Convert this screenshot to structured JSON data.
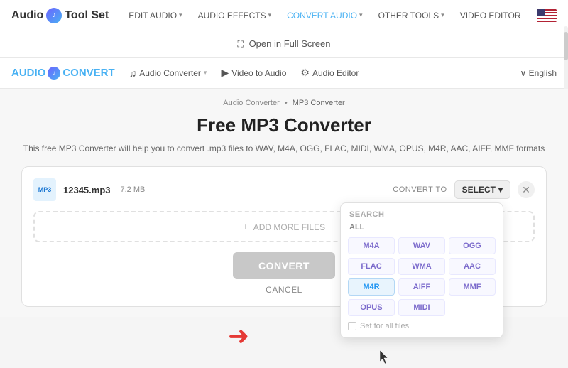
{
  "logo": {
    "text_before": "Audio",
    "text_after": "Tool Set",
    "icon_letter": "♪"
  },
  "top_nav": {
    "items": [
      {
        "label": "EDIT AUDIO",
        "has_chevron": true,
        "active": false
      },
      {
        "label": "AUDIO EFFECTS",
        "has_chevron": true,
        "active": false
      },
      {
        "label": "CONVERT AUDIO",
        "has_chevron": true,
        "active": true
      },
      {
        "label": "OTHER TOOLS",
        "has_chevron": true,
        "active": false
      },
      {
        "label": "VIDEO EDITOR",
        "has_chevron": false,
        "active": false
      }
    ]
  },
  "fullscreen_bar": {
    "text": "Open in Full Screen",
    "icon": "⛶"
  },
  "inner_nav": {
    "logo": "AUDIO",
    "logo_icon": "♪",
    "logo_suffix": "CONVERT",
    "items": [
      {
        "label": "Audio Converter",
        "icon": "♫",
        "has_chevron": true
      },
      {
        "label": "Video to Audio",
        "icon": "▶"
      },
      {
        "label": "Audio Editor",
        "icon": "⚙"
      }
    ],
    "language": "English"
  },
  "breadcrumb": {
    "parent": "Audio Converter",
    "current": "MP3 Converter"
  },
  "page": {
    "title": "Free MP3 Converter",
    "description": "This free MP3 Converter will help you to convert .mp3 files to WAV, M4A, OGG, FLAC, MIDI, WMA, OPUS, M4R, AAC, AIFF, MMF formats"
  },
  "file": {
    "name": "12345.mp3",
    "size": "7.2 MB",
    "icon_label": "MP3"
  },
  "converter": {
    "convert_to_label": "CONVERT TO",
    "select_btn_label": "SELECT",
    "select_chevron": "▾",
    "add_more_label": "ADD MORE FILES",
    "convert_btn": "CONVERT",
    "cancel_btn": "CANCEL"
  },
  "dropdown": {
    "search_label": "SEARCH",
    "all_label": "ALL",
    "formats": [
      {
        "label": "M4A",
        "highlighted": false
      },
      {
        "label": "WAV",
        "highlighted": false
      },
      {
        "label": "OGG",
        "highlighted": false
      },
      {
        "label": "FLAC",
        "highlighted": false
      },
      {
        "label": "WMA",
        "highlighted": false
      },
      {
        "label": "AAC",
        "highlighted": false
      },
      {
        "label": "M4R",
        "highlighted": true
      },
      {
        "label": "AIFF",
        "highlighted": false
      },
      {
        "label": "MMF",
        "highlighted": false
      },
      {
        "label": "OPUS",
        "highlighted": false
      },
      {
        "label": "MIDI",
        "highlighted": false
      }
    ],
    "set_for_all": "Set for all files"
  }
}
